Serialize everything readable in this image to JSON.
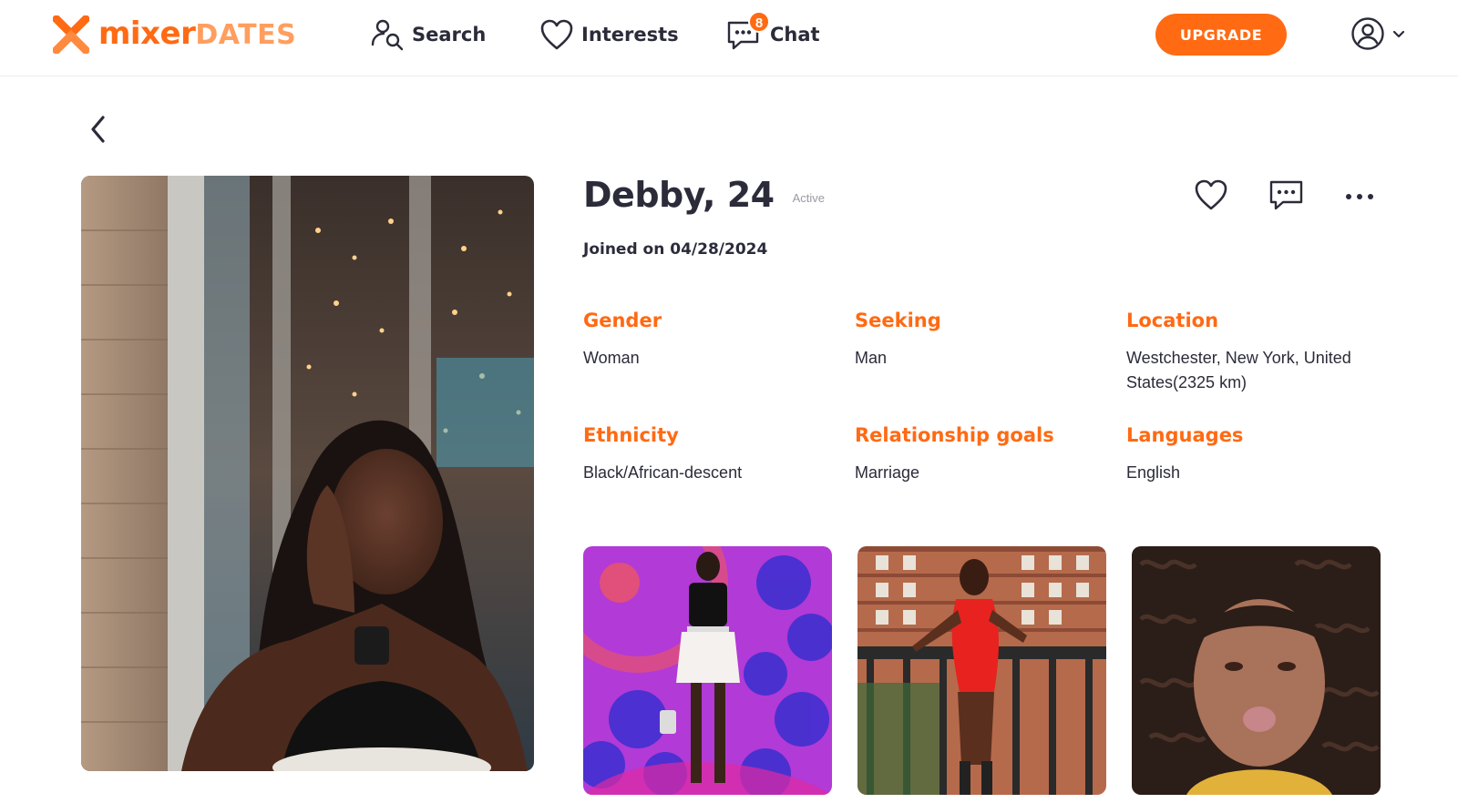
{
  "brand": {
    "name_part1": "mixer",
    "name_part2": "DATES",
    "primary_color": "#ff6a13",
    "secondary_color": "#ff9e5e"
  },
  "nav": {
    "search_label": "Search",
    "interests_label": "Interests",
    "chat_label": "Chat",
    "chat_badge_count": "8"
  },
  "header": {
    "upgrade_label": "UPGRADE"
  },
  "profile": {
    "name_age": "Debby, 24",
    "status": "Active",
    "joined": "Joined on 04/28/2024",
    "attributes": [
      {
        "label": "Gender",
        "value": "Woman"
      },
      {
        "label": "Seeking",
        "value": "Man"
      },
      {
        "label": "Location",
        "value": "Westchester, New York, United States(2325 km)"
      },
      {
        "label": "Ethnicity",
        "value": "Black/African-descent"
      },
      {
        "label": "Relationship goals",
        "value": "Marriage"
      },
      {
        "label": "Languages",
        "value": "English"
      }
    ]
  },
  "icons": {
    "back": "chevron-left-icon",
    "search": "user-search-icon",
    "interests": "heart-icon",
    "chat": "chat-bubble-icon",
    "account": "user-circle-icon",
    "like": "heart-outline-icon",
    "message": "message-icon",
    "more": "more-dots-icon"
  }
}
